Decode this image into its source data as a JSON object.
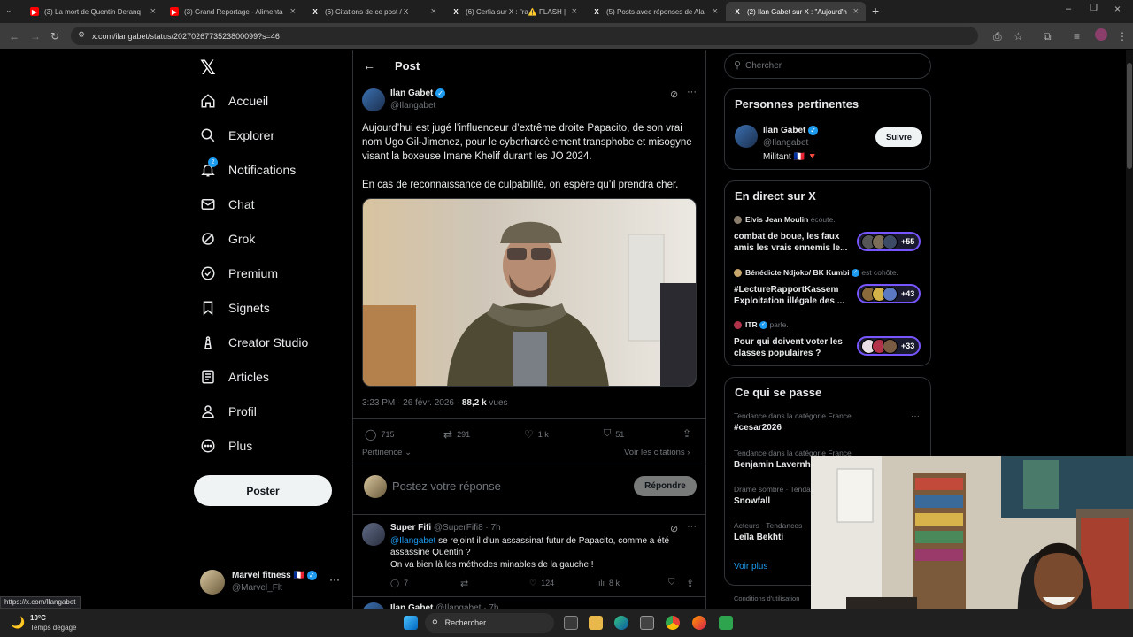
{
  "browser": {
    "tabs": [
      {
        "label": "(3) La mort de Quentin Deranq",
        "icon": "youtube-icon",
        "color": "#ff0000"
      },
      {
        "label": "(3) Grand Reportage - Alimenta",
        "icon": "youtube-icon",
        "color": "#ff0000"
      },
      {
        "label": "(6) Citations de ce post / X",
        "icon": "x-logo-icon",
        "color": "#ffffff"
      },
      {
        "label": "(6) Cerfia sur X : \"ra⚠️ FLASH |",
        "icon": "x-logo-icon",
        "color": "#ffffff"
      },
      {
        "label": "(5) Posts avec réponses de Alai",
        "icon": "x-logo-icon",
        "color": "#ffffff"
      },
      {
        "label": "(2) Ilan Gabet sur X : \"Aujourd'h",
        "icon": "x-logo-icon",
        "color": "#ffffff"
      }
    ],
    "url": "x.com/ilangabet/status/2027026773523800099?s=46",
    "status_url": "https://x.com/Ilangabet"
  },
  "nav": {
    "items": [
      {
        "label": "Accueil",
        "icon": "home-icon"
      },
      {
        "label": "Explorer",
        "icon": "search-icon"
      },
      {
        "label": "Notifications",
        "icon": "bell-icon",
        "badge": "2"
      },
      {
        "label": "Chat",
        "icon": "mail-icon"
      },
      {
        "label": "Grok",
        "icon": "grok-icon"
      },
      {
        "label": "Premium",
        "icon": "premium-icon"
      },
      {
        "label": "Signets",
        "icon": "bookmark-icon"
      },
      {
        "label": "Creator Studio",
        "icon": "creator-icon"
      },
      {
        "label": "Articles",
        "icon": "articles-icon"
      },
      {
        "label": "Profil",
        "icon": "user-icon"
      },
      {
        "label": "Plus",
        "icon": "more-circle-icon"
      }
    ],
    "post_button": "Poster",
    "account": {
      "name": "Marvel fitness 🇫🇷",
      "handle": "@Marvel_Flt"
    }
  },
  "post": {
    "header": "Post",
    "author": "Ilan Gabet",
    "handle": "@Ilangabet",
    "text1": "Aujourd’hui est jugé l’influenceur d’extrême droite Papacito, de son vrai nom Ugo Gil-Jimenez, pour le cyberharcèlement transphobe et misogyne visant la boxeuse Imane Khelif durant les JO 2024.",
    "text2": "En cas de reconnaissance de culpabilité, on espère qu’il prendra cher.",
    "time": "3:23 PM · 26 févr. 2026 · ",
    "views": "88,2 k",
    "views_label": " vues",
    "stats": {
      "replies": "715",
      "reposts": "291",
      "likes": "1 k",
      "bookmarks": "51"
    },
    "sort_label": "Pertinence",
    "quotes_link": "Voir les citations",
    "reply_placeholder": "Postez votre réponse",
    "reply_button": "Répondre"
  },
  "reply": {
    "author": "Super Fifi",
    "handle": "@SuperFifi8 · 7h",
    "mention": "@Ilangabet",
    "text1": " se rejoint il d'un assassinat futur de Papacito, comme a été assassiné Quentin ?",
    "text2": "On va bien là les méthodes minables de la gauche !",
    "stats": {
      "replies": "7",
      "likes": "124",
      "views": "8 k"
    },
    "next_author": "Ilan Gabet",
    "next_handle": "@Ilangabet · 7h"
  },
  "right": {
    "search_placeholder": "Chercher",
    "relevant_title": "Personnes pertinentes",
    "person": {
      "name": "Ilan Gabet",
      "handle": "@Ilangabet",
      "bio": "Militant 🇫🇷 🔻",
      "follow": "Suivre"
    },
    "live_title": "En direct sur X",
    "live": [
      {
        "host": "Elvis Jean Moulin",
        "action": " écoute.",
        "title": "combat de boue, les faux amis les vrais ennemis le...",
        "count": "+55"
      },
      {
        "host": "Bénédicte Ndjoko/ BK Kumbi",
        "action": " est cohôte.",
        "title": "#LectureRapportKassem Exploitation illégale des ...",
        "count": "+43"
      },
      {
        "host": "ITR",
        "action": " parle.",
        "title": "Pour qui doivent voter les classes populaires ?",
        "count": "+33"
      }
    ],
    "trends_title": "Ce qui se passe",
    "trends": [
      {
        "meta": "Tendance dans la catégorie France",
        "name": "#cesar2026"
      },
      {
        "meta": "Tendance dans la catégorie France",
        "name": "Benjamin Lavernh"
      },
      {
        "meta": "Drame sombre · Tenda",
        "name": "Snowfall"
      },
      {
        "meta": "Acteurs · Tendances",
        "name": "Leïla Bekhti"
      }
    ],
    "show_more": "Voir plus",
    "footer": "Conditions d'utilisation"
  },
  "taskbar": {
    "temp": "10°C",
    "weather": "Temps dégagé",
    "search": "Rechercher"
  }
}
